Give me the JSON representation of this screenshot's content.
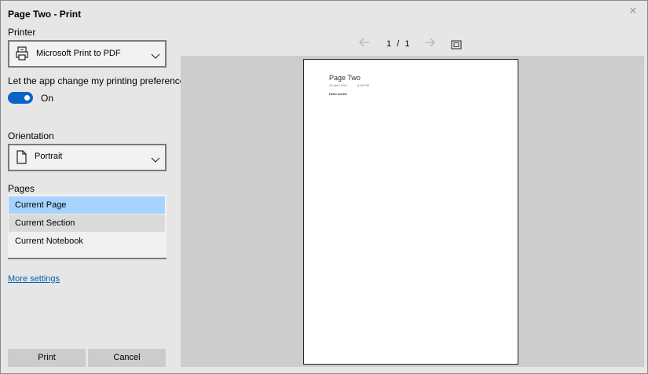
{
  "window": {
    "title": "Page Two - Print"
  },
  "printer": {
    "label": "Printer",
    "value": "Microsoft Print to PDF"
  },
  "preferences": {
    "label": "Let the app change my printing preferences",
    "toggle_state": "On",
    "enabled": true
  },
  "orientation": {
    "label": "Orientation",
    "value": "Portrait"
  },
  "pages": {
    "label": "Pages",
    "options": [
      "Current Page",
      "Current Section",
      "Current Notebook"
    ],
    "selected_index": 0
  },
  "more_settings": "More settings",
  "buttons": {
    "print": "Print",
    "cancel": "Cancel"
  },
  "preview": {
    "page_current": "1",
    "page_separator": "/",
    "page_total": "1",
    "doc_title": "Page Two",
    "doc_date": "28 April 2021",
    "doc_time": "8:46 PM",
    "doc_body": "Hello world!"
  },
  "colors": {
    "accent": "#0a63c7",
    "selected_option": "#a6d4ff",
    "hover_option": "#dadada",
    "link": "#0063b1"
  }
}
